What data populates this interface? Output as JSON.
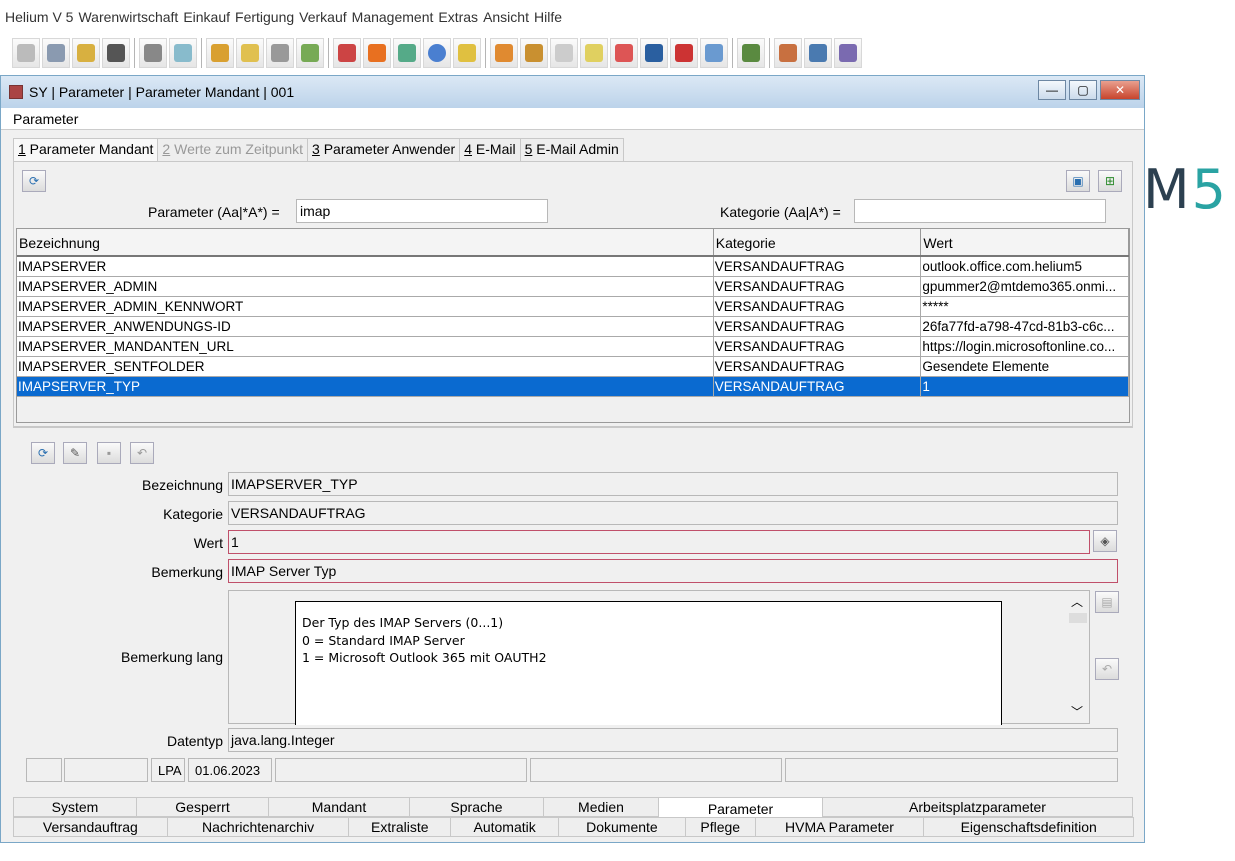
{
  "menubar": [
    "Helium V 5",
    "Warenwirtschaft",
    "Einkauf",
    "Fertigung",
    "Verkauf",
    "Management",
    "Extras",
    "Ansicht",
    "Hilfe"
  ],
  "logo": {
    "m": "M",
    "five": "5"
  },
  "window": {
    "title": "SY | Parameter | Parameter Mandant | 001",
    "minimize": "—",
    "maximize": "▢",
    "close": "✕",
    "section_label": "Parameter"
  },
  "tabs": [
    {
      "num": "1",
      "label": " Parameter Mandant"
    },
    {
      "num": "2",
      "label": " Werte zum Zeitpunkt"
    },
    {
      "num": "3",
      "label": " Parameter Anwender"
    },
    {
      "num": "4",
      "label": " E-Mail"
    },
    {
      "num": "5",
      "label": " E-Mail Admin"
    }
  ],
  "filter": {
    "param_label": "Parameter (Aa|*A*)  =",
    "param_value": "imap",
    "kategorie_label": "Kategorie (Aa|A*)  =",
    "kategorie_value": ""
  },
  "table": {
    "headers": [
      "Bezeichnung",
      "Kategorie",
      "Wert"
    ],
    "rows": [
      [
        "IMAPSERVER",
        "VERSANDAUFTRAG",
        "outlook.office.com.helium5"
      ],
      [
        "IMAPSERVER_ADMIN",
        "VERSANDAUFTRAG",
        "gpummer2@mtdemo365.onmi..."
      ],
      [
        "IMAPSERVER_ADMIN_KENNWORT",
        "VERSANDAUFTRAG",
        "*****"
      ],
      [
        "IMAPSERVER_ANWENDUNGS-ID",
        "VERSANDAUFTRAG",
        "26fa77fd-a798-47cd-81b3-c6c..."
      ],
      [
        "IMAPSERVER_MANDANTEN_URL",
        "VERSANDAUFTRAG",
        "https://login.microsoftonline.co..."
      ],
      [
        "IMAPSERVER_SENTFOLDER",
        "VERSANDAUFTRAG",
        "Gesendete Elemente"
      ],
      [
        "IMAPSERVER_TYP",
        "VERSANDAUFTRAG",
        "1"
      ]
    ]
  },
  "detail": {
    "bezeichnung_label": "Bezeichnung",
    "bezeichnung": "IMAPSERVER_TYP",
    "kategorie_label": "Kategorie",
    "kategorie": "VERSANDAUFTRAG",
    "wert_label": "Wert",
    "wert": "1",
    "bemerkung_label": "Bemerkung",
    "bemerkung": "IMAP Server Typ",
    "bemerkung_lang_label": "Bemerkung lang",
    "bemerkung_lang": "Der Typ des IMAP Servers (0...1)\n0 = Standard IMAP Server\n1 = Microsoft Outlook 365 mit OAUTH2",
    "datentyp_label": "Datentyp",
    "datentyp": "java.lang.Integer"
  },
  "status": {
    "user": "LPA",
    "date": "01.06.2023"
  },
  "bottom_tabs_row1": [
    "System",
    "Gesperrt",
    "Mandant",
    "Sprache",
    "Medien",
    "Parameter",
    "Arbeitsplatzparameter"
  ],
  "bottom_tabs_row2": [
    "Versandauftrag",
    "Nachrichtenarchiv",
    "Extraliste",
    "Automatik",
    "Dokumente",
    "Pflege",
    "HVMA Parameter",
    "Eigenschaftsdefinition"
  ]
}
